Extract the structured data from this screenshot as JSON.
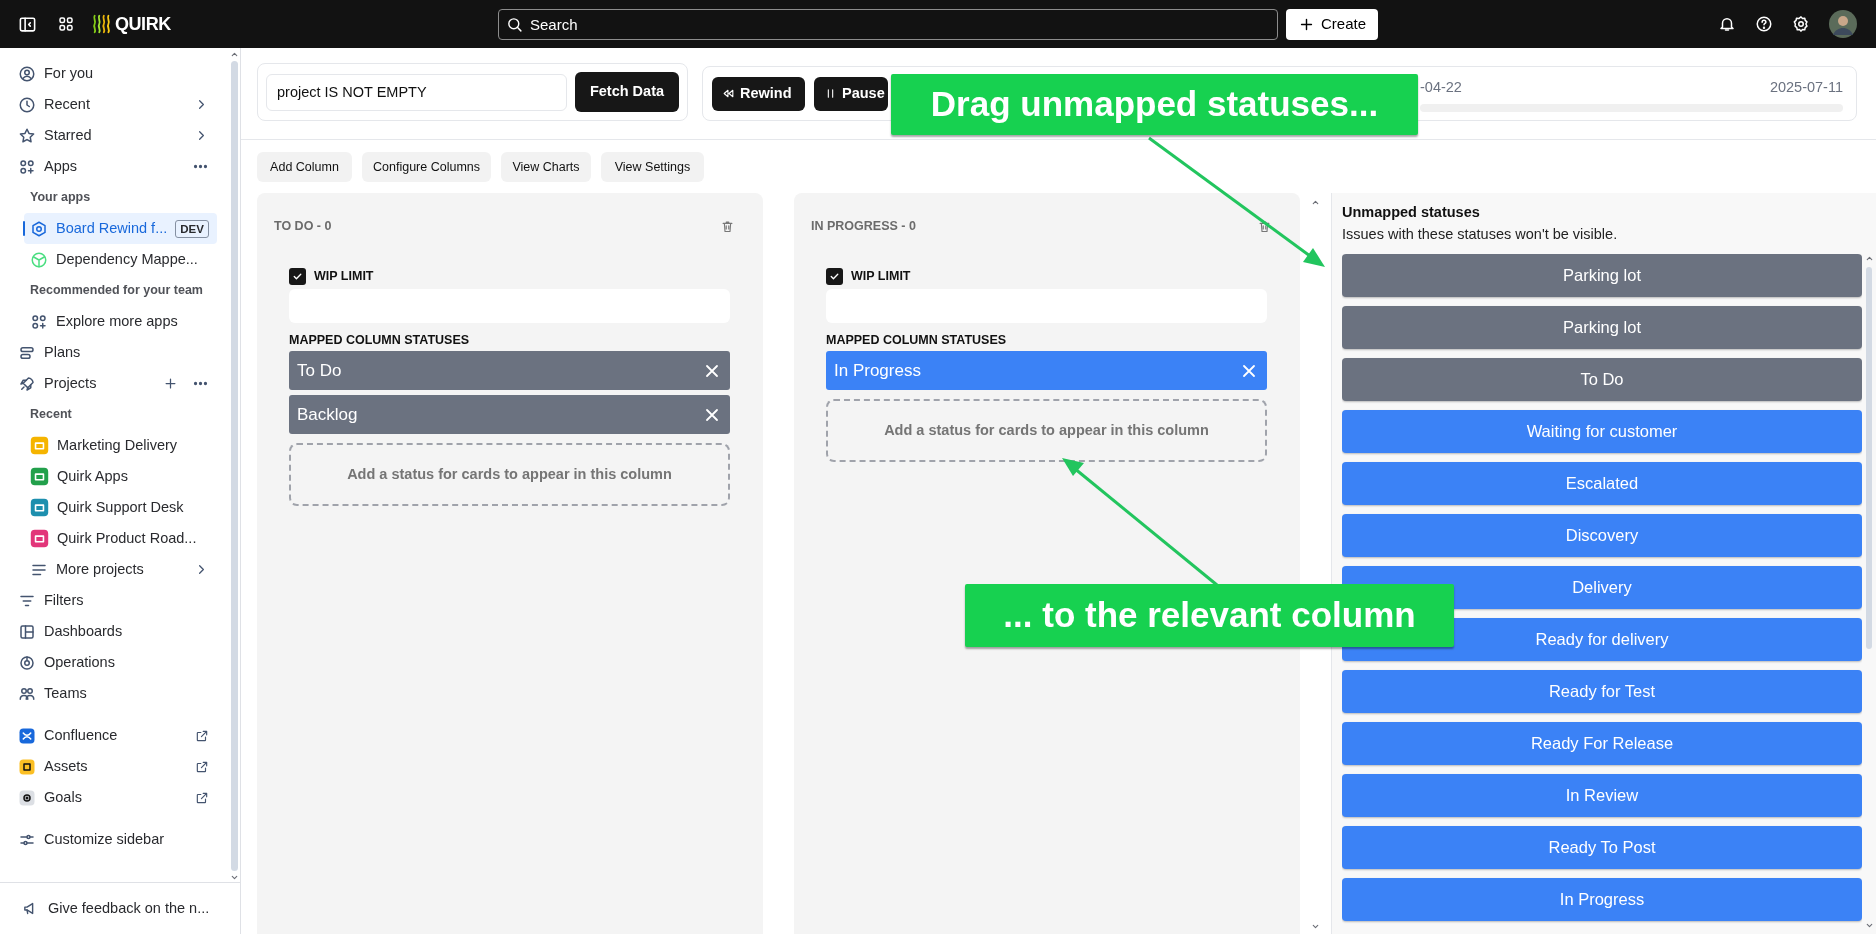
{
  "topbar": {
    "logo": "QUIRK",
    "search": {
      "placeholder": "Search"
    },
    "create_button": "Create"
  },
  "sidebar": {
    "groups": [
      {
        "items": [
          {
            "kind": "nav",
            "label": "For you",
            "selected": false
          },
          {
            "kind": "nav",
            "label": "Recent",
            "selected": false
          },
          {
            "kind": "nav",
            "label": "Starred",
            "selected": false
          },
          {
            "kind": "nav",
            "label": "Apps",
            "selected": false
          },
          {
            "kind": "section",
            "label": "Your apps"
          },
          {
            "kind": "sub",
            "label": "Board Rewind f...",
            "badge": "DEV",
            "selected": true
          },
          {
            "kind": "sub",
            "label": "Dependency Mappe...",
            "selected": false
          },
          {
            "kind": "section",
            "label": "Recommended for your team"
          },
          {
            "kind": "sub",
            "label": "Explore more apps",
            "selected": false
          },
          {
            "kind": "nav",
            "label": "Plans",
            "selected": false
          },
          {
            "kind": "nav",
            "label": "Projects",
            "selected": false
          },
          {
            "kind": "section",
            "label": "Recent"
          },
          {
            "kind": "project",
            "label": "Marketing Delivery",
            "color": "#f5b400",
            "selected": false
          },
          {
            "kind": "project",
            "label": "Quirk Apps",
            "color": "#22a04b",
            "selected": false
          },
          {
            "kind": "project",
            "label": "Quirk Support Desk",
            "color": "#1d8fae",
            "selected": false
          },
          {
            "kind": "project",
            "label": "Quirk Product Road...",
            "color": "#e2367a",
            "selected": false
          },
          {
            "kind": "sub",
            "label": "More projects",
            "selected": false
          },
          {
            "kind": "nav",
            "label": "Filters",
            "selected": false
          },
          {
            "kind": "nav",
            "label": "Dashboards",
            "selected": false
          },
          {
            "kind": "nav",
            "label": "Operations",
            "selected": false
          },
          {
            "kind": "nav",
            "label": "Teams",
            "selected": false
          }
        ]
      },
      {
        "items": [
          {
            "kind": "nav",
            "label": "Confluence",
            "selected": false
          },
          {
            "kind": "nav",
            "label": "Assets",
            "selected": false
          },
          {
            "kind": "nav",
            "label": "Goals",
            "selected": false
          }
        ]
      },
      {
        "items": [
          {
            "kind": "nav",
            "label": "Customize sidebar",
            "selected": false
          }
        ]
      }
    ],
    "footer": "Give feedback on the n..."
  },
  "query": {
    "value": "project IS NOT EMPTY",
    "button": "Fetch Data"
  },
  "playback": {
    "buttons": [
      {
        "kind": "rewind",
        "label": "Rewind"
      },
      {
        "kind": "pause",
        "label": "Pause"
      }
    ],
    "start_date": "-04-22",
    "end_date": "2025-07-11"
  },
  "toolbar": [
    "Add Column",
    "Configure Columns",
    "View Charts",
    "View Settings"
  ],
  "columns": [
    {
      "title": "TO DO - 0",
      "wip_limit": {
        "label": "WIP LIMIT",
        "checked": true
      },
      "statuses_label": "MAPPED COLUMN STATUSES",
      "statuses": [
        {
          "label": "To Do",
          "color": "#6b7280"
        },
        {
          "label": "Backlog",
          "color": "#6b7280"
        }
      ],
      "dropzone": "Add a status for cards to appear in this column"
    },
    {
      "title": "IN PROGRESS - 0",
      "wip_limit": {
        "label": "WIP LIMIT",
        "checked": true
      },
      "statuses_label": "MAPPED COLUMN STATUSES",
      "statuses": [
        {
          "label": "In Progress",
          "color": "#3b82f6"
        }
      ],
      "dropzone": "Add a status for cards to appear in this column"
    }
  ],
  "unmapped": {
    "title": "Unmapped statuses",
    "subtitle": "Issues with these statuses won't be visible.",
    "statuses": [
      {
        "label": "Parking lot",
        "color": "#6b7280"
      },
      {
        "label": "Parking lot",
        "color": "#6b7280"
      },
      {
        "label": "To Do",
        "color": "#6b7280"
      },
      {
        "label": "Waiting for customer",
        "color": "#3b82f6"
      },
      {
        "label": "Escalated",
        "color": "#3b82f6"
      },
      {
        "label": "Discovery",
        "color": "#3b82f6"
      },
      {
        "label": "Delivery",
        "color": "#3b82f6"
      },
      {
        "label": "Ready for delivery",
        "color": "#3b82f6"
      },
      {
        "label": "Ready for Test",
        "color": "#3b82f6"
      },
      {
        "label": "Ready For Release",
        "color": "#3b82f6"
      },
      {
        "label": "In Review",
        "color": "#3b82f6"
      },
      {
        "label": "Ready To Post",
        "color": "#3b82f6"
      },
      {
        "label": "In Progress",
        "color": "#3b82f6"
      }
    ]
  },
  "annotations": [
    {
      "text": "Drag unmapped statuses..."
    },
    {
      "text": "... to the relevant column"
    }
  ]
}
